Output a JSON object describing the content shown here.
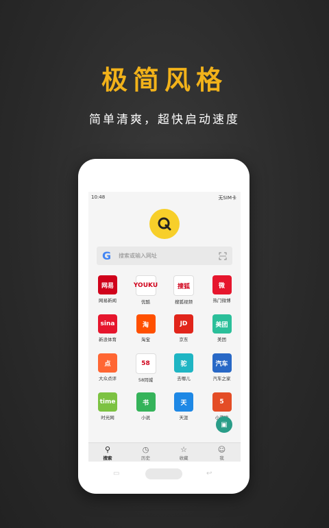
{
  "headline": "极简风格",
  "subline": "简单清爽，超快启动速度",
  "status": {
    "time": "10:48",
    "right": "无SIM卡"
  },
  "search": {
    "placeholder": "搜索或输入网址",
    "engine_icon": "google-g-icon"
  },
  "apps": [
    {
      "label": "网易新闻",
      "icon_text": "网易",
      "color": "#d0021b"
    },
    {
      "label": "优酷",
      "icon_text": "YOUKU",
      "color": "#ffffff"
    },
    {
      "label": "搜狐视频",
      "icon_text": "搜狐",
      "color": "#ffffff"
    },
    {
      "label": "热门微博",
      "icon_text": "微",
      "color": "#e6162d"
    },
    {
      "label": "新浪体育",
      "icon_text": "sina",
      "color": "#e6162d"
    },
    {
      "label": "淘宝",
      "icon_text": "淘",
      "color": "#ff5000"
    },
    {
      "label": "京东",
      "icon_text": "JD",
      "color": "#e1251b"
    },
    {
      "label": "美团",
      "icon_text": "美团",
      "color": "#2bbf9a"
    },
    {
      "label": "大众点评",
      "icon_text": "点",
      "color": "#ff6633"
    },
    {
      "label": "58同城",
      "icon_text": "58",
      "color": "#ffffff"
    },
    {
      "label": "去哪儿",
      "icon_text": "驼",
      "color": "#1fb5c3"
    },
    {
      "label": "汽车之家",
      "icon_text": "汽车",
      "color": "#2868c6"
    },
    {
      "label": "时光网",
      "icon_text": "time",
      "color": "#7cc242"
    },
    {
      "label": "小说",
      "icon_text": "书",
      "color": "#35b35a"
    },
    {
      "label": "天涯",
      "icon_text": "天",
      "color": "#1e88e5"
    },
    {
      "label": "小游戏",
      "icon_text": "5",
      "color": "#e44d26"
    }
  ],
  "tabs": [
    {
      "label": "搜索",
      "icon": "⚲"
    },
    {
      "label": "历史",
      "icon": "◷"
    },
    {
      "label": "收藏",
      "icon": "☆"
    },
    {
      "label": "我",
      "icon": "☺"
    }
  ]
}
